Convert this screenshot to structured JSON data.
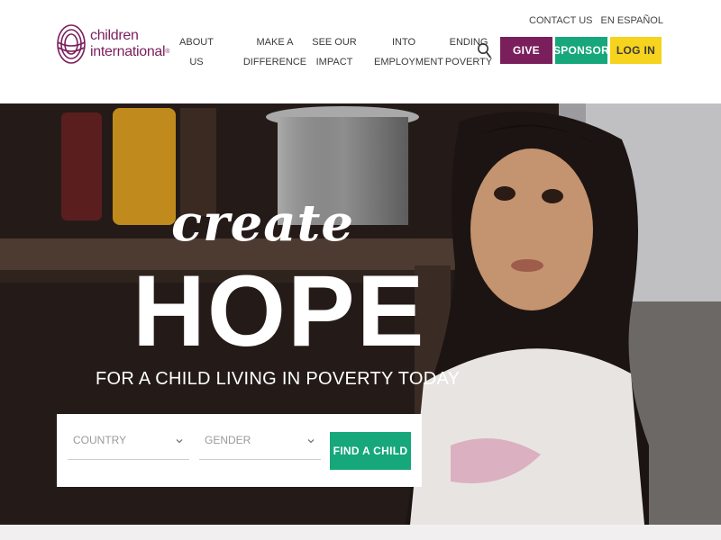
{
  "brand": {
    "logo_line1": "children",
    "logo_line2": "international",
    "logo_mark": "®",
    "color": "#7a1f5c"
  },
  "utility_nav": [
    {
      "label": "CONTACT US"
    },
    {
      "label": "EN ESPAÑOL"
    }
  ],
  "main_nav": [
    {
      "line1": "ABOUT",
      "line2": "US"
    },
    {
      "line1": "MAKE A",
      "line2": "DIFFERENCE"
    },
    {
      "line1": "SEE OUR",
      "line2": "IMPACT"
    },
    {
      "line1": "INTO",
      "line2": "EMPLOYMENT"
    },
    {
      "line1": "ENDING",
      "line2": "POVERTY"
    }
  ],
  "icons": {
    "search": "search-icon",
    "chevron": "chevron-down-icon"
  },
  "cta": {
    "give": {
      "label": "GIVE",
      "color": "#7a1f5c"
    },
    "sponsor": {
      "label": "SPONSOR",
      "color": "#16a77a"
    },
    "login": {
      "label": "LOG IN",
      "color": "#f6d31c"
    }
  },
  "hero": {
    "create": "create",
    "hope": "HOPE",
    "subline": "FOR A CHILD LIVING IN POVERTY TODAY"
  },
  "finder": {
    "country_label": "COUNTRY",
    "gender_label": "GENDER",
    "button_label": "FIND A CHILD",
    "button_color": "#16a77a"
  }
}
